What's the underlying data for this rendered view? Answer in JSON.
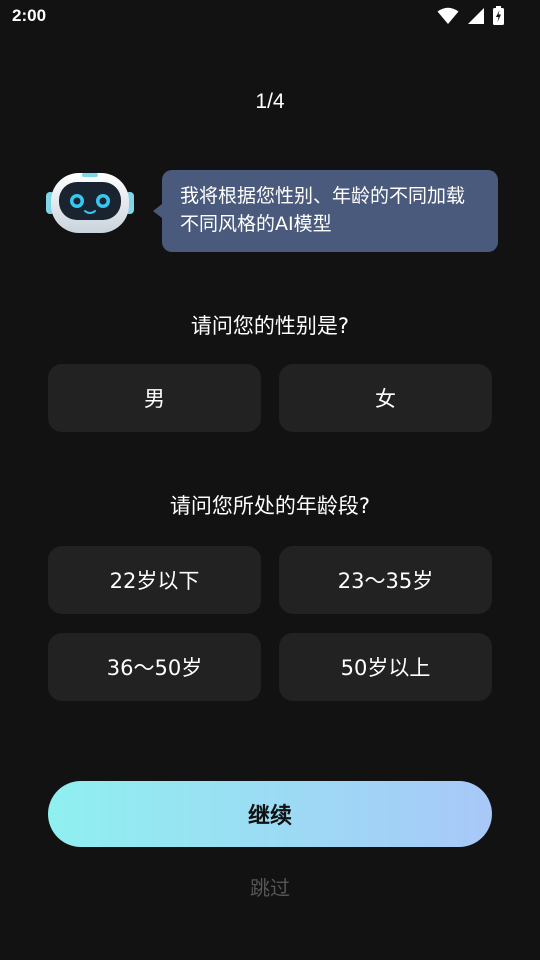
{
  "status_bar": {
    "time": "2:00",
    "icons": [
      "wifi-icon",
      "signal-icon",
      "battery-charging-icon"
    ]
  },
  "progress": {
    "label": "1/4"
  },
  "assistant": {
    "avatar": "robot-icon",
    "message_line1": "我将根据您性别、年龄的不同加载",
    "message_line2": "不同风格的AI模型"
  },
  "gender_question": {
    "title": "请问您的性别是?",
    "options": [
      "男",
      "女"
    ]
  },
  "age_question": {
    "title": "请问您所处的年龄段?",
    "options": [
      "22岁以下",
      "23～35岁",
      "36～50岁",
      "50岁以上"
    ]
  },
  "actions": {
    "continue_label": "继续",
    "skip_label": "跳过"
  },
  "colors": {
    "background": "#121212",
    "bubble": "#4a5a7c",
    "option_bg": "#222222",
    "continue_gradient_start": "#8ff0f0",
    "continue_gradient_end": "#a8c8f8",
    "skip_text": "#555555"
  }
}
